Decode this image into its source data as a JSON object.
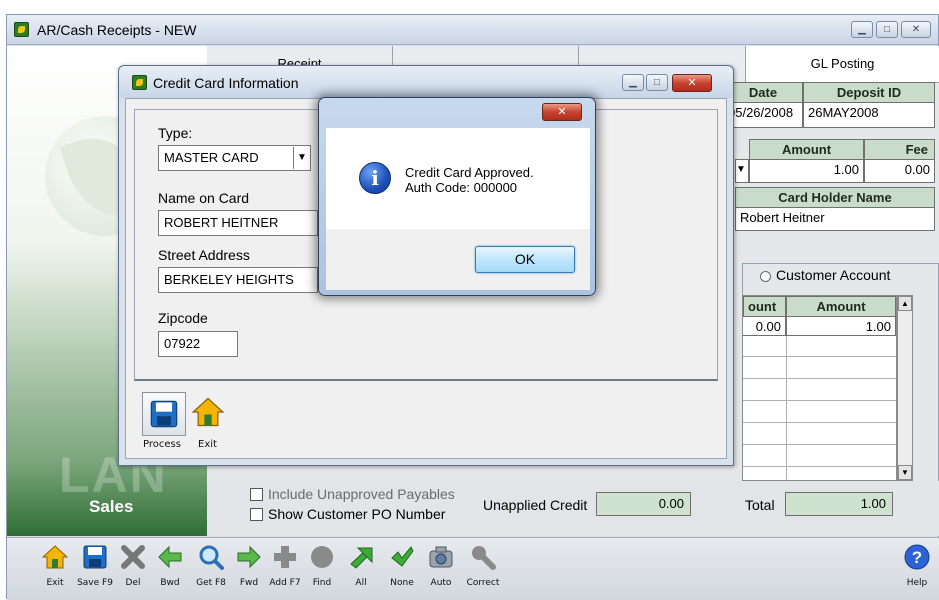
{
  "window": {
    "title": "AR/Cash Receipts - NEW"
  },
  "tabs": [
    "Receipt",
    "",
    "",
    "GL Posting"
  ],
  "header_grid": {
    "date_label": "Date",
    "date_value": "05/26/2008",
    "deposit_label": "Deposit ID",
    "deposit_value": "26MAY2008",
    "amount_label": "Amount",
    "amount_value": "1.00",
    "fee_label": "Fee",
    "fee_value": "0.00",
    "card_holder_label": "Card Holder Name",
    "card_holder_value": "Robert Heitner"
  },
  "customer_account_option": "Customer Account",
  "lower_grid": {
    "col1": "ount",
    "col2": "Amount",
    "row1": [
      "0.00",
      "1.00"
    ]
  },
  "bottom": {
    "include_unapproved": "Include Unapproved Payables",
    "show_po": "Show Customer PO Number",
    "unapplied_credit_label": "Unapplied Credit",
    "unapplied_credit_value": "0.00",
    "total_label": "Total",
    "total_value": "1.00"
  },
  "left_panel": {
    "section": "Sales"
  },
  "toolbar": {
    "items": [
      "Exit",
      "Save F9",
      "Del",
      "Bwd",
      "Get F8",
      "Fwd",
      "Add F7",
      "Find",
      "All",
      "None",
      "Auto",
      "Correct"
    ],
    "help": "Help"
  },
  "credit_card_dialog": {
    "title": "Credit Card Information",
    "type_label": "Type:",
    "type_value": "MASTER CARD",
    "name_label": "Name on Card",
    "name_value": "ROBERT HEITNER",
    "street_label": "Street Address",
    "street_value": "BERKELEY HEIGHTS",
    "zip_label": "Zipcode",
    "zip_value": "07922",
    "process_label": "Process",
    "exit_label": "Exit"
  },
  "message_box": {
    "line1": "Credit Card Approved.",
    "line2": "Auth Code: 000000",
    "ok_label": "OK"
  },
  "colors": {
    "grid_header": "#c9dcc9",
    "accent_green": "#2f6e35",
    "dialog_frame": "#a9c3e2"
  }
}
